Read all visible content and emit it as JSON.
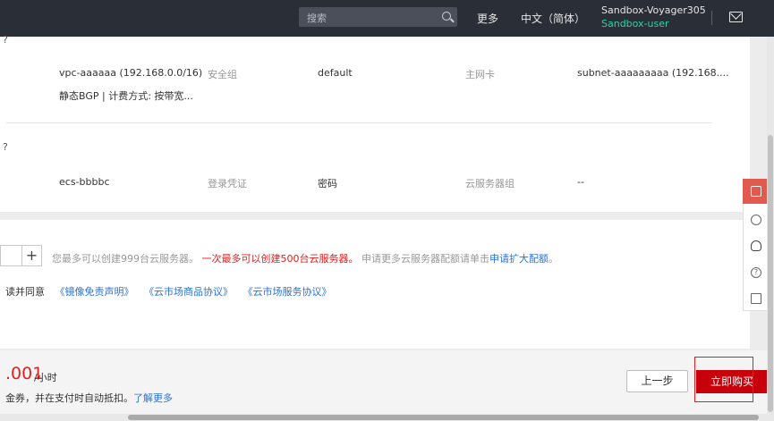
{
  "topbar": {
    "search_placeholder": "搜索",
    "more": "更多",
    "language": "中文（简体）",
    "account_name": "Sandbox-Voyager305",
    "user_name": "Sandbox-user"
  },
  "network_section": {
    "edge_mark": "?",
    "vpc": "vpc-aaaaaa (192.168.0.0/16)",
    "security_group_label": "安全组",
    "security_group_value": "default",
    "nic_label": "主网卡",
    "subnet": "subnet-aaaaaaaaa (192.168....",
    "bandwidth": "静态BGP | 计费方式: 按带宽..."
  },
  "ecs_section": {
    "edge_mark": "?",
    "name": "ecs-bbbbc",
    "credential_label": "登录凭证",
    "credential_value": "密码",
    "server_group_label": "云服务器组",
    "server_group_value": "--"
  },
  "quantity": {
    "plus": "+",
    "note_1": "您最多可以创建999台云服务器。",
    "note_red": "一次最多可以创建500台云服务器。",
    "note_2": "申请更多云服务器配额请单击",
    "note_link": "申请扩大配额",
    "note_end": "。"
  },
  "agreement": {
    "prefix": "读并同意",
    "links": [
      "《镜像免责声明》",
      "《云市场商品协议》",
      "《云市场服务协议》"
    ]
  },
  "footer": {
    "price": ".001",
    "unit": "/小时",
    "coupon_text": "金券，并在支付时自动抵扣。",
    "coupon_link": "了解更多",
    "prev_button": "上一步",
    "buy_button": "立即购买"
  },
  "colors": {
    "accent_red": "#c7000b",
    "link_blue": "#2b73d8",
    "user_green": "#2ed3a5",
    "topbar_bg": "#2a2e36"
  },
  "side_tools": [
    "chat-icon",
    "smile-icon",
    "robot-icon",
    "help-icon",
    "edit-icon"
  ]
}
